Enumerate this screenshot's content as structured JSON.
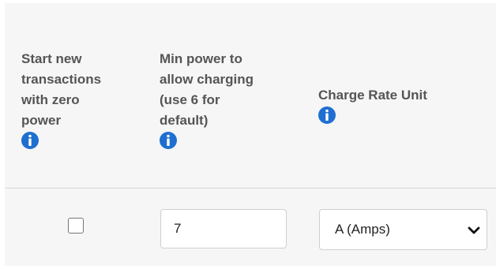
{
  "columns": [
    {
      "lines": [
        "Start new",
        "transactions",
        "with zero",
        "power"
      ],
      "info_icon": "info-icon"
    },
    {
      "lines": [
        "Min power to",
        "allow charging",
        "(use 6 for",
        "default)"
      ],
      "info_icon": "info-icon"
    },
    {
      "lines": [
        "Charge Rate Unit"
      ],
      "info_icon": "info-icon"
    }
  ],
  "row": {
    "zero_power_checked": false,
    "min_power_value": "7",
    "charge_rate_unit_selected": "A (Amps)"
  },
  "colors": {
    "info_blue": "#1f6fd1",
    "header_text": "#555555",
    "panel_bg": "#f6f6f6"
  }
}
